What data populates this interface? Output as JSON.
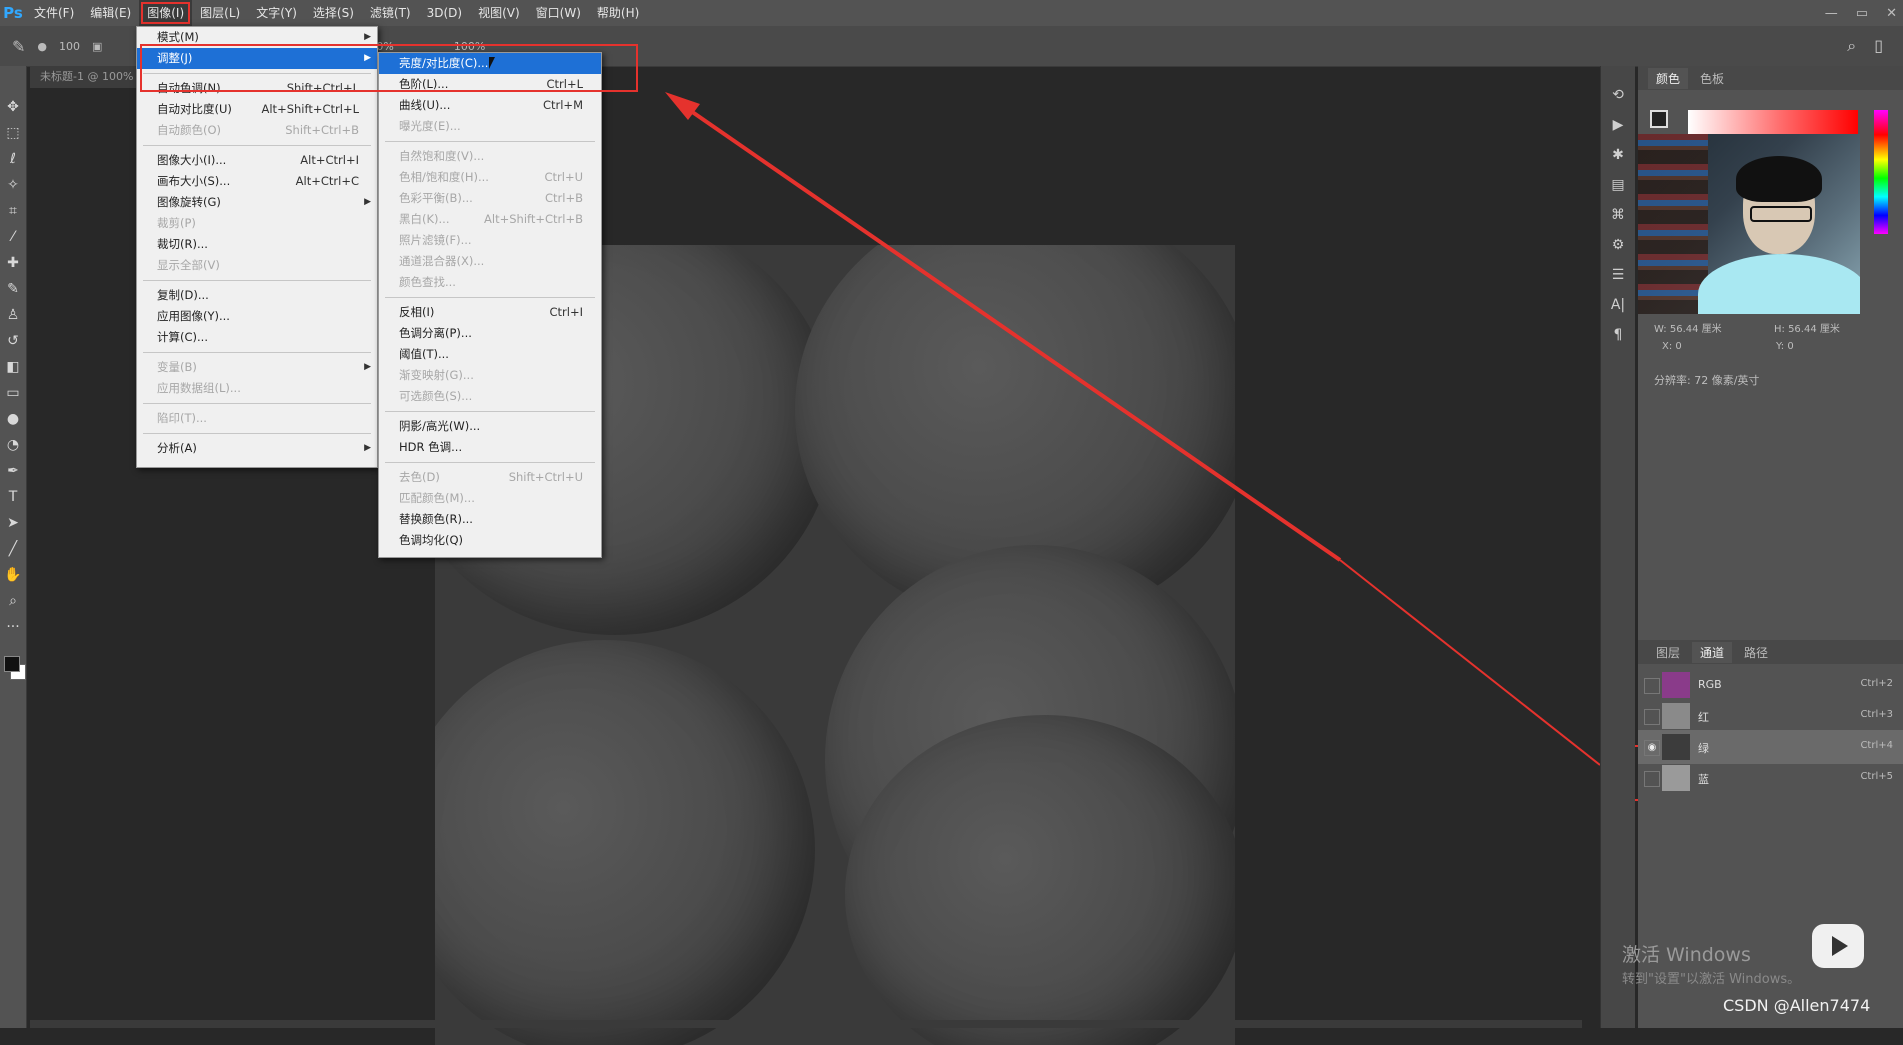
{
  "app": {
    "logo": "Ps",
    "menu": [
      "文件(F)",
      "编辑(E)",
      "图像(I)",
      "图层(L)",
      "文字(Y)",
      "选择(S)",
      "滤镜(T)",
      "3D(D)",
      "视图(V)",
      "窗口(W)",
      "帮助(H)"
    ],
    "active_menu_index": 2,
    "window_controls": [
      "—",
      "▭",
      "✕"
    ]
  },
  "options_bar": {
    "brush_size": "100",
    "opacity_value": "100%",
    "flow_value": "100%"
  },
  "document": {
    "tab_title": "未标题-1 @ 100%"
  },
  "image_menu": {
    "items": [
      {
        "label": "模式(M)",
        "shortcut": "",
        "submenu": true,
        "disabled": false
      },
      {
        "label": "调整(J)",
        "shortcut": "",
        "submenu": true,
        "disabled": false,
        "highlighted": true
      },
      {
        "sep": true
      },
      {
        "label": "自动色调(N)",
        "shortcut": "Shift+Ctrl+L",
        "disabled": false
      },
      {
        "label": "自动对比度(U)",
        "shortcut": "Alt+Shift+Ctrl+L",
        "disabled": false
      },
      {
        "label": "自动颜色(O)",
        "shortcut": "Shift+Ctrl+B",
        "disabled": true
      },
      {
        "sep": true
      },
      {
        "label": "图像大小(I)...",
        "shortcut": "Alt+Ctrl+I",
        "disabled": false
      },
      {
        "label": "画布大小(S)...",
        "shortcut": "Alt+Ctrl+C",
        "disabled": false
      },
      {
        "label": "图像旋转(G)",
        "shortcut": "",
        "submenu": true,
        "disabled": false
      },
      {
        "label": "裁剪(P)",
        "shortcut": "",
        "disabled": true
      },
      {
        "label": "裁切(R)...",
        "shortcut": "",
        "disabled": false
      },
      {
        "label": "显示全部(V)",
        "shortcut": "",
        "disabled": true
      },
      {
        "sep": true
      },
      {
        "label": "复制(D)...",
        "shortcut": "",
        "disabled": false
      },
      {
        "label": "应用图像(Y)...",
        "shortcut": "",
        "disabled": false
      },
      {
        "label": "计算(C)...",
        "shortcut": "",
        "disabled": false
      },
      {
        "sep": true
      },
      {
        "label": "变量(B)",
        "shortcut": "",
        "submenu": true,
        "disabled": true
      },
      {
        "label": "应用数据组(L)...",
        "shortcut": "",
        "disabled": true
      },
      {
        "sep": true
      },
      {
        "label": "陷印(T)...",
        "shortcut": "",
        "disabled": true
      },
      {
        "sep": true
      },
      {
        "label": "分析(A)",
        "shortcut": "",
        "submenu": true,
        "disabled": false
      }
    ]
  },
  "adjust_menu": {
    "items": [
      {
        "label": "亮度/对比度(C)...",
        "shortcut": "",
        "highlighted": true,
        "disabled": false
      },
      {
        "label": "色阶(L)...",
        "shortcut": "Ctrl+L",
        "disabled": false
      },
      {
        "label": "曲线(U)...",
        "shortcut": "Ctrl+M",
        "disabled": false
      },
      {
        "label": "曝光度(E)...",
        "shortcut": "",
        "disabled": true
      },
      {
        "sep": true
      },
      {
        "label": "自然饱和度(V)...",
        "shortcut": "",
        "disabled": true
      },
      {
        "label": "色相/饱和度(H)...",
        "shortcut": "Ctrl+U",
        "disabled": true
      },
      {
        "label": "色彩平衡(B)...",
        "shortcut": "Ctrl+B",
        "disabled": true
      },
      {
        "label": "黑白(K)...",
        "shortcut": "Alt+Shift+Ctrl+B",
        "disabled": true
      },
      {
        "label": "照片滤镜(F)...",
        "shortcut": "",
        "disabled": true
      },
      {
        "label": "通道混合器(X)...",
        "shortcut": "",
        "disabled": true
      },
      {
        "label": "颜色查找...",
        "shortcut": "",
        "disabled": true
      },
      {
        "sep": true
      },
      {
        "label": "反相(I)",
        "shortcut": "Ctrl+I",
        "disabled": false
      },
      {
        "label": "色调分离(P)...",
        "shortcut": "",
        "disabled": false
      },
      {
        "label": "阈值(T)...",
        "shortcut": "",
        "disabled": false
      },
      {
        "label": "渐变映射(G)...",
        "shortcut": "",
        "disabled": true
      },
      {
        "label": "可选颜色(S)...",
        "shortcut": "",
        "disabled": true
      },
      {
        "sep": true
      },
      {
        "label": "阴影/高光(W)...",
        "shortcut": "",
        "disabled": false
      },
      {
        "label": "HDR 色调...",
        "shortcut": "",
        "disabled": false
      },
      {
        "sep": true
      },
      {
        "label": "去色(D)",
        "shortcut": "Shift+Ctrl+U",
        "disabled": true
      },
      {
        "label": "匹配颜色(M)...",
        "shortcut": "",
        "disabled": true
      },
      {
        "label": "替换颜色(R)...",
        "shortcut": "",
        "disabled": false
      },
      {
        "label": "色调均化(Q)",
        "shortcut": "",
        "disabled": false
      }
    ]
  },
  "color_panel": {
    "tabs": [
      "颜色",
      "色板"
    ],
    "active_tab": 0
  },
  "properties": {
    "w": "W: 56.44 厘米",
    "h": "H: 56.44 厘米",
    "x": "X: 0",
    "y": "Y: 0",
    "resolution": "分辨率: 72 像素/英寸"
  },
  "channels_panel": {
    "tabs": [
      "图层",
      "通道",
      "路径"
    ],
    "active_tab": 1,
    "rows": [
      {
        "name": "RGB",
        "shortcut": "Ctrl+2",
        "visible": false,
        "selected": false,
        "thumb": "#8a3b8a"
      },
      {
        "name": "红",
        "shortcut": "Ctrl+3",
        "visible": false,
        "selected": false,
        "thumb": "#8a8a8a"
      },
      {
        "name": "绿",
        "shortcut": "Ctrl+4",
        "visible": true,
        "selected": true,
        "thumb": "#3c3c3c"
      },
      {
        "name": "蓝",
        "shortcut": "Ctrl+5",
        "visible": false,
        "selected": false,
        "thumb": "#9a9a9a"
      }
    ]
  },
  "overlay": {
    "activate_title": "激活 Windows",
    "activate_sub": "转到\"设置\"以激活 Windows。",
    "watermark": "CSDN @Allen7474"
  },
  "colors": {
    "highlight_blue": "#1e70d6",
    "annotation_red": "#e5322d",
    "ps_blue": "#31a8ff"
  }
}
